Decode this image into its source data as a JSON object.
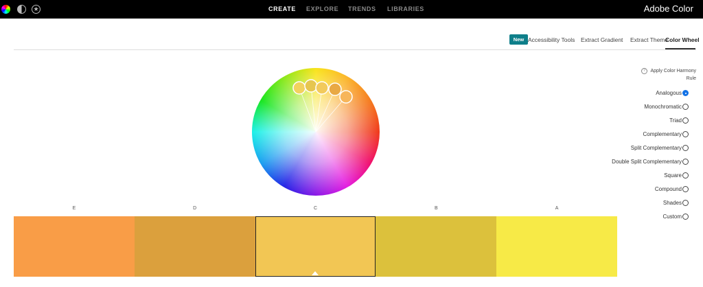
{
  "app": {
    "brand": "Adobe Color"
  },
  "nav": {
    "items": [
      "CREATE",
      "EXPLORE",
      "TRENDS",
      "LIBRARIES"
    ],
    "active": "CREATE"
  },
  "tabs": {
    "new_badge": "New",
    "items": [
      "Accessibility Tools",
      "Extract Gradient",
      "Extract Theme",
      "Color Wheel"
    ],
    "active": "Color Wheel"
  },
  "harmony": {
    "help_label": "Apply Color Harmony Rule",
    "selected": "Analogous",
    "rules": [
      "Analogous",
      "Monochromatic",
      "Triad",
      "Complementary",
      "Split Complementary",
      "Double Split Complementary",
      "Square",
      "Compound",
      "Shades",
      "Custom"
    ]
  },
  "swatches": [
    {
      "label": "E",
      "color": "#F99D47"
    },
    {
      "label": "D",
      "color": "#DBA03D"
    },
    {
      "label": "C",
      "color": "#F2C654",
      "selected": true
    },
    {
      "label": "B",
      "color": "#DCC13C"
    },
    {
      "label": "A",
      "color": "#F7EA47"
    }
  ],
  "wheel_handles": [
    {
      "color": "#F2D25E"
    },
    {
      "color": "#E6C650"
    },
    {
      "color": "#F2CA5C"
    },
    {
      "color": "#E9A944"
    },
    {
      "color": "#F7B65B"
    }
  ]
}
